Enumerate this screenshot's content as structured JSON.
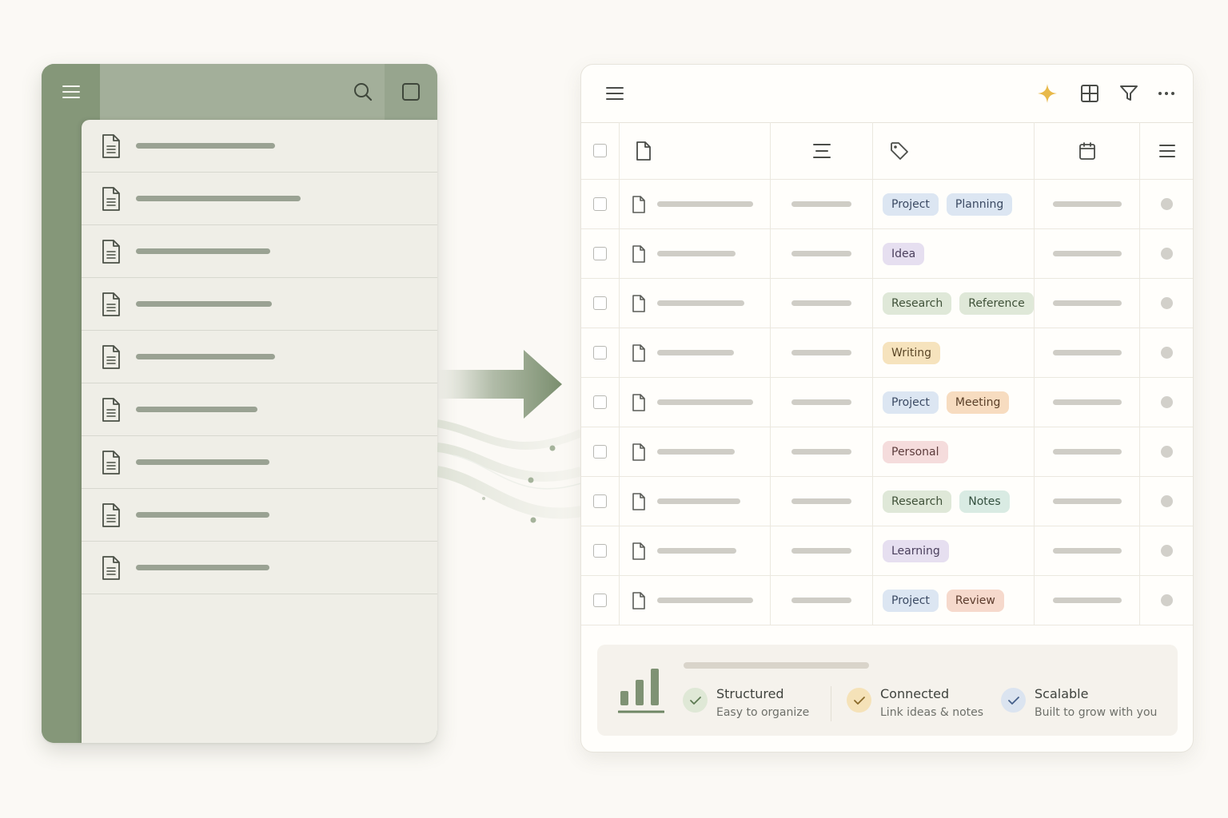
{
  "left_app": {
    "icons": {
      "menu": "menu-icon",
      "search": "search-icon",
      "square": "square-icon",
      "document": "document-icon"
    },
    "doc_count": 9
  },
  "right_app": {
    "toolbar_icons": [
      "menu-icon",
      "sparkle-icon",
      "grid-view-icon",
      "filter-icon",
      "more-icon"
    ],
    "column_icons": [
      "checkbox",
      "document-icon",
      "text-lines-icon",
      "tag-icon",
      "calendar-icon",
      "menu-icon"
    ],
    "rows": [
      {
        "tags": [
          {
            "label": "Project",
            "color": "blue"
          },
          {
            "label": "Planning",
            "color": "blue"
          }
        ]
      },
      {
        "tags": [
          {
            "label": "Idea",
            "color": "purple"
          }
        ]
      },
      {
        "tags": [
          {
            "label": "Research",
            "color": "green"
          },
          {
            "label": "Reference",
            "color": "green"
          }
        ]
      },
      {
        "tags": [
          {
            "label": "Writing",
            "color": "yellow"
          }
        ]
      },
      {
        "tags": [
          {
            "label": "Project",
            "color": "blue"
          },
          {
            "label": "Meeting",
            "color": "orange"
          }
        ]
      },
      {
        "tags": [
          {
            "label": "Personal",
            "color": "pink"
          }
        ]
      },
      {
        "tags": [
          {
            "label": "Research",
            "color": "green"
          },
          {
            "label": "Notes",
            "color": "teal"
          }
        ]
      },
      {
        "tags": [
          {
            "label": "Learning",
            "color": "purple"
          }
        ]
      },
      {
        "tags": [
          {
            "label": "Project",
            "color": "blue"
          },
          {
            "label": "Review",
            "color": "salmon"
          }
        ]
      }
    ],
    "tag_colors": {
      "blue": {
        "bg": "#dce6f2",
        "fg": "#3b4a63"
      },
      "purple": {
        "bg": "#e6dff0",
        "fg": "#4a3f5c"
      },
      "green": {
        "bg": "#dfe8d8",
        "fg": "#3f5138"
      },
      "yellow": {
        "bg": "#f6e3bd",
        "fg": "#5a4626"
      },
      "orange": {
        "bg": "#f7dcc0",
        "fg": "#5a3f28"
      },
      "pink": {
        "bg": "#f5dcdc",
        "fg": "#5c3b3b"
      },
      "teal": {
        "bg": "#d9ebe3",
        "fg": "#34503f"
      },
      "salmon": {
        "bg": "#f6d9cc",
        "fg": "#5c3b2c"
      }
    },
    "footer": {
      "features": [
        {
          "title": "Structured",
          "subtitle": "Easy to organize",
          "circle_color": "#dfe8d6",
          "check_color": "#5d7a53"
        },
        {
          "title": "Connected",
          "subtitle": "Link ideas & notes",
          "circle_color": "#f5e2b8",
          "check_color": "#8a6a2a"
        },
        {
          "title": "Scalable",
          "subtitle": "Built to grow with you",
          "circle_color": "#dbe4f0",
          "check_color": "#46608a"
        }
      ]
    }
  },
  "colors": {
    "sage": "#7f9274",
    "sage_dark": "#6f8765",
    "sparkle": "#e8b94a"
  }
}
